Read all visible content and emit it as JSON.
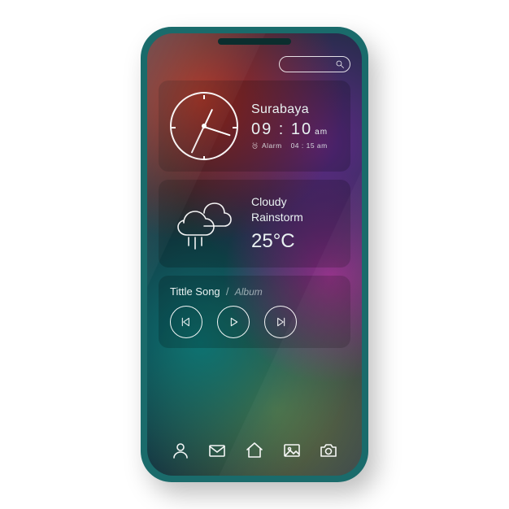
{
  "search": {
    "placeholder": ""
  },
  "clock": {
    "location": "Surabaya",
    "time": "09 : 10",
    "ampm": "am",
    "alarm_label": "Alarm",
    "alarm_time": "04 : 15 am"
  },
  "weather": {
    "condition_line1": "Cloudy",
    "condition_line2": "Rainstorm",
    "temperature": "25°C"
  },
  "music": {
    "title": "Tittle Song",
    "separator": "/",
    "album": "Album"
  },
  "dock": {
    "items": [
      "profile",
      "mail",
      "home",
      "gallery",
      "camera"
    ]
  }
}
